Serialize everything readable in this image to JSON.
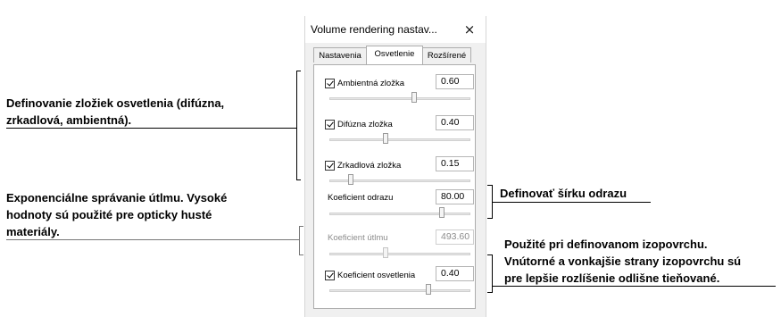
{
  "annotations": {
    "lighting_components": {
      "line1": "Definovanie zložiek osvetlenia (difúzna,",
      "line2": "zrkadlová, ambientná)."
    },
    "attenuation": {
      "line1": "Exponenciálne správanie útlmu. Vysoké",
      "line2": "hodnoty sú použité pre opticky husté",
      "line3": "materiály."
    },
    "reflection_width": {
      "line1": "Definovať šírku odrazu"
    },
    "isosurface": {
      "line1": "Použité pri definovanom izopovrchu.",
      "line2": "Vnútorné a vonkajšie strany izopovrchu sú",
      "line3": "pre lepšie rozlíšenie odlišne tieňované."
    }
  },
  "dialog": {
    "title": "Volume rendering nastav...",
    "close_icon": "×",
    "tabs": [
      {
        "label": "Nastavenia",
        "active": false
      },
      {
        "label": "Osvetlenie",
        "active": true
      },
      {
        "label": "Rozšírené",
        "active": false
      }
    ],
    "rows": [
      {
        "label": "Ambientná zložka",
        "value": "0.60",
        "checked": true,
        "enabled": true,
        "slider_fraction": 0.6
      },
      {
        "label": "Difúzna zložka",
        "value": "0.40",
        "checked": true,
        "enabled": true,
        "slider_fraction": 0.4
      },
      {
        "label": "Zrkadlová zložka",
        "value": "0.15",
        "checked": true,
        "enabled": true,
        "slider_fraction": 0.15
      },
      {
        "label": "Koeficient odrazu",
        "value": "80.00",
        "checked": null,
        "enabled": true,
        "slider_fraction": 0.8
      },
      {
        "label": "Koeficient útlmu",
        "value": "493.60",
        "checked": null,
        "enabled": false,
        "slider_fraction": 0.4
      },
      {
        "label": "Koeficient osvetlenia",
        "value": "0.40",
        "checked": true,
        "enabled": true,
        "slider_fraction": 0.7
      }
    ]
  }
}
